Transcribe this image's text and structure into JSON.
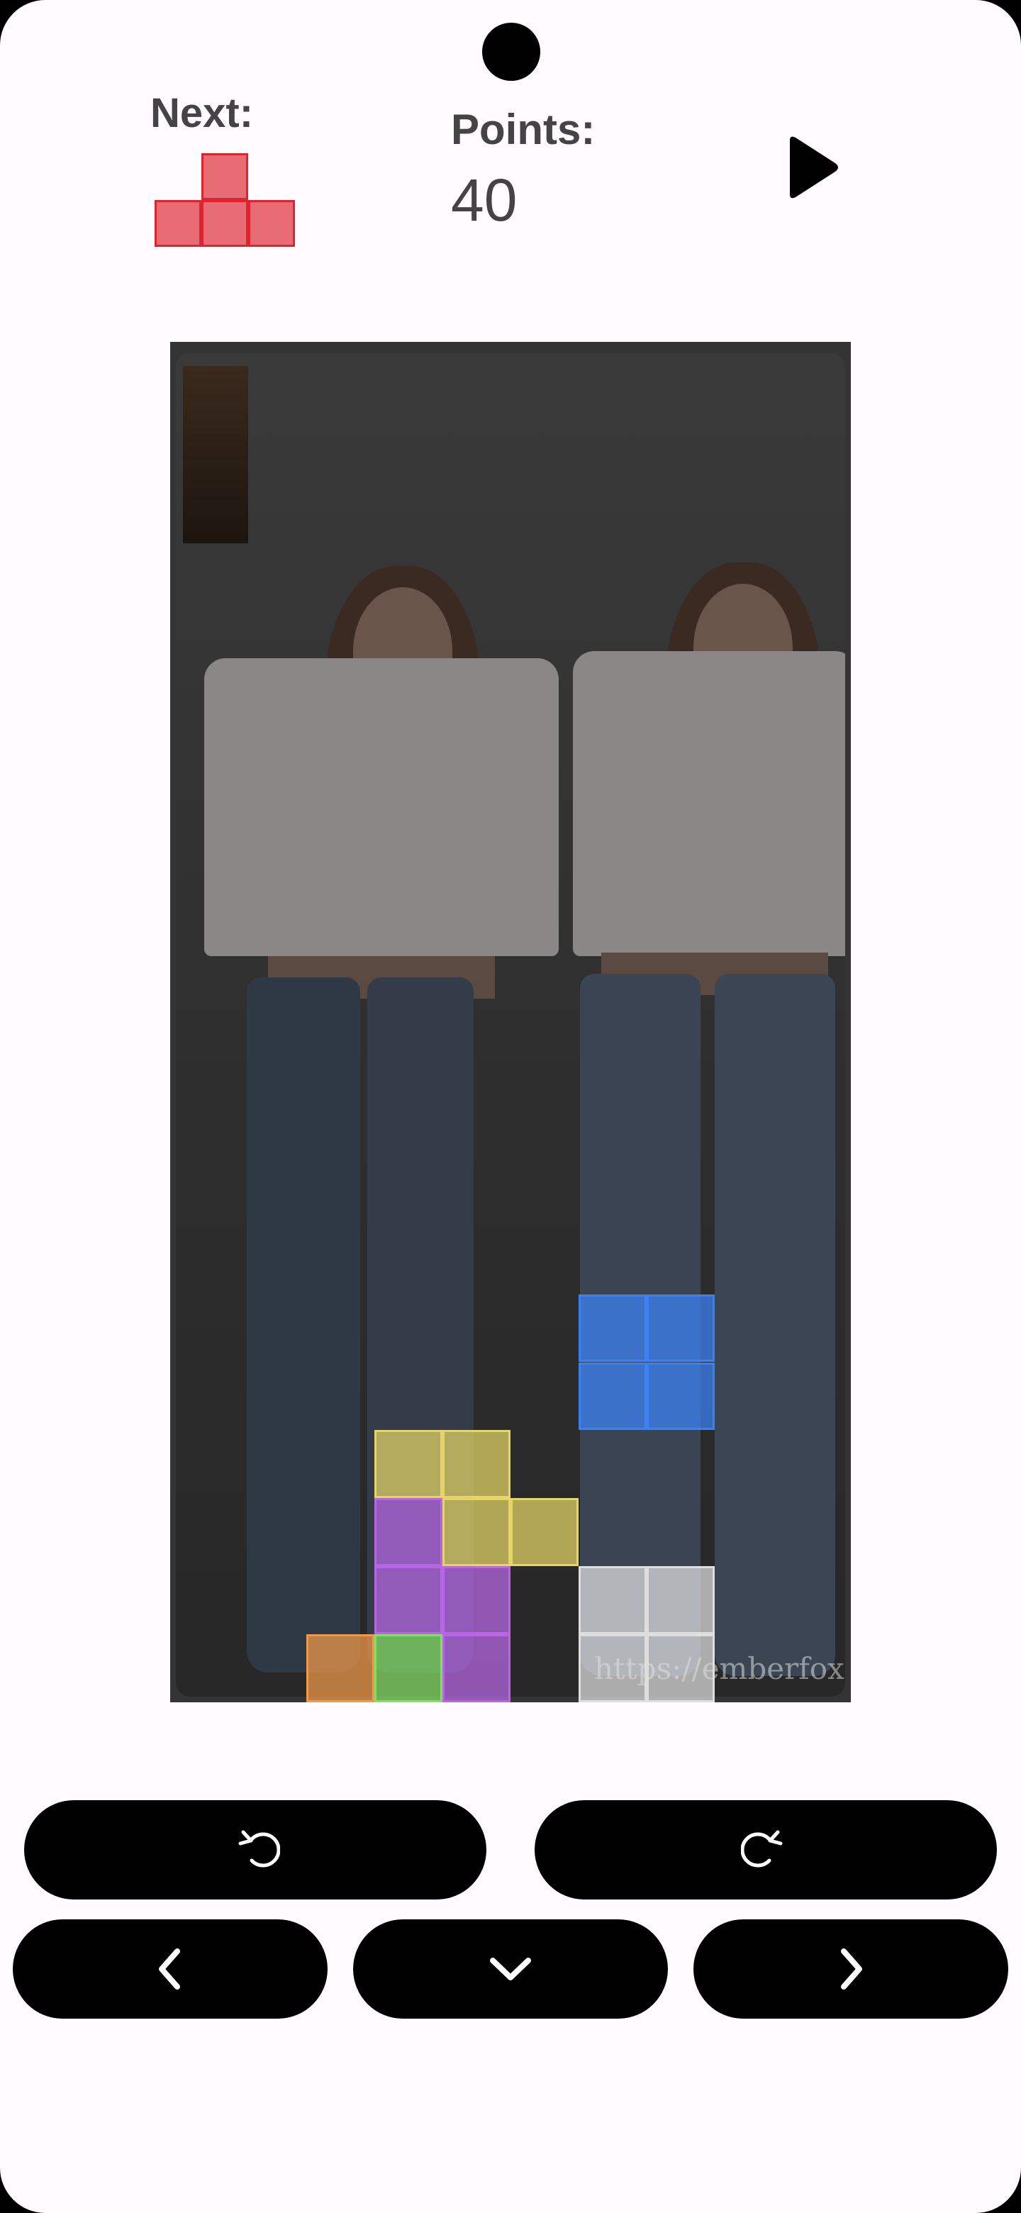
{
  "header": {
    "next_label": "Next:",
    "points_label": "Points:",
    "points_value": "40",
    "play_icon": "play-icon",
    "next_piece": {
      "shape": "T",
      "color": "#dc2832",
      "cells": [
        [
          1,
          0
        ],
        [
          0,
          1
        ],
        [
          1,
          1
        ],
        [
          2,
          1
        ]
      ]
    }
  },
  "board": {
    "columns": 10,
    "rows": 20,
    "background_image": "photo of two young women in white crop tops and jeans",
    "watermark": "https://emberfox",
    "blocks": [
      {
        "piece": "O",
        "color": "#3b82f6",
        "cells": [
          [
            6,
            14
          ],
          [
            7,
            14
          ],
          [
            6,
            15
          ],
          [
            7,
            15
          ]
        ]
      },
      {
        "piece": "S",
        "color": "#e6d768",
        "cells": [
          [
            3,
            16
          ],
          [
            4,
            16
          ],
          [
            4,
            17
          ],
          [
            5,
            17
          ]
        ]
      },
      {
        "piece": "T",
        "color": "#b968e6",
        "cells": [
          [
            3,
            17
          ],
          [
            3,
            18
          ],
          [
            4,
            18
          ],
          [
            4,
            19
          ]
        ]
      },
      {
        "piece": "single",
        "color": "#f29b4a",
        "cells": [
          [
            2,
            19
          ]
        ]
      },
      {
        "piece": "single",
        "color": "#86e066",
        "cells": [
          [
            3,
            19
          ]
        ]
      },
      {
        "piece": "O",
        "color": "#e0e0e0",
        "cells": [
          [
            6,
            18
          ],
          [
            7,
            18
          ],
          [
            6,
            19
          ],
          [
            7,
            19
          ]
        ]
      }
    ]
  },
  "controls": {
    "rotate_left_icon": "rotate-left-icon",
    "rotate_right_icon": "rotate-right-icon",
    "move_left_icon": "chevron-left-icon",
    "move_down_icon": "chevron-down-icon",
    "move_right_icon": "chevron-right-icon"
  }
}
